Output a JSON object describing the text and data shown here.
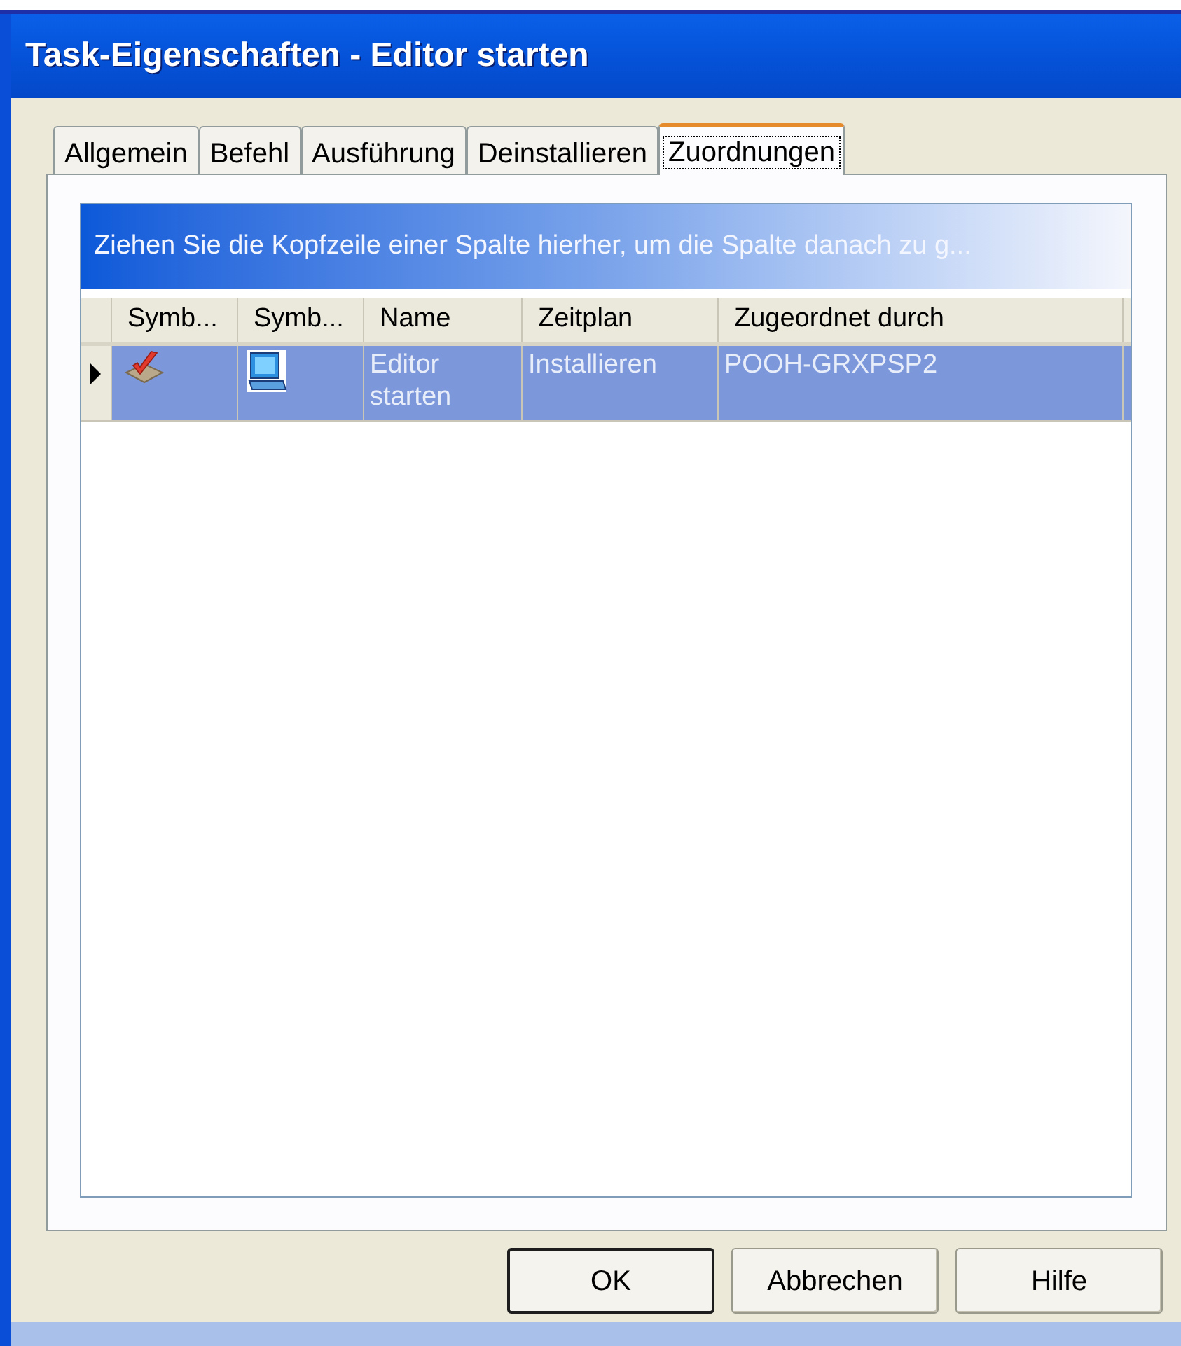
{
  "window": {
    "title": "Task-Eigenschaften - Editor starten"
  },
  "tabs": [
    {
      "label": "Allgemein",
      "selected": false
    },
    {
      "label": "Befehl",
      "selected": false
    },
    {
      "label": "Ausführung",
      "selected": false
    },
    {
      "label": "Deinstallieren",
      "selected": false
    },
    {
      "label": "Zuordnungen",
      "selected": true
    }
  ],
  "grid": {
    "group_prompt": "Ziehen Sie die Kopfzeile einer Spalte hierher, um die Spalte danach zu g...",
    "columns": [
      "Symb...",
      "Symb...",
      "Name",
      "Zeitplan",
      "Zugeordnet durch"
    ],
    "rows": [
      {
        "selected": true,
        "current": true,
        "name": "Editor starten",
        "schedule": "Installieren",
        "assigned_by": "POOH-GRXPSP2"
      }
    ]
  },
  "buttons": [
    {
      "label": "OK",
      "default": true
    },
    {
      "label": "Abbrechen",
      "default": false
    },
    {
      "label": "Hilfe",
      "default": false
    }
  ]
}
